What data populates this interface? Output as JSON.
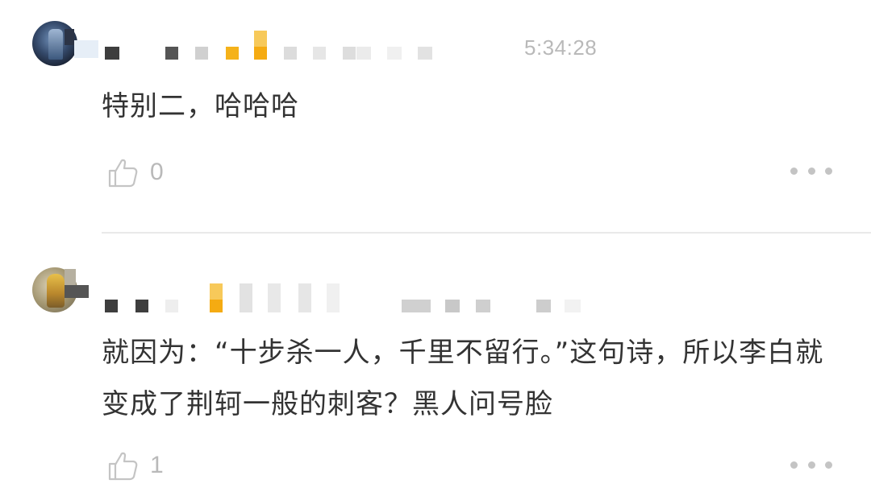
{
  "comments": [
    {
      "timestamp": "5:34:28",
      "text": "特别二，哈哈哈",
      "likes": "0",
      "like_icon": "thumbs-up-icon",
      "more_icon": "more-dots-icon"
    },
    {
      "timestamp": "",
      "text": "就因为：“十步杀一人，千里不留行。”这句诗，所以李白就变成了荆轲一般的刺客？黑人问号脸",
      "likes": "1",
      "like_icon": "thumbs-up-icon",
      "more_icon": "more-dots-icon"
    }
  ],
  "colors": {
    "text": "#333333",
    "meta": "#b9b9b9",
    "divider": "#e9e9e9",
    "mosaic_accent": "#f5b21a"
  }
}
